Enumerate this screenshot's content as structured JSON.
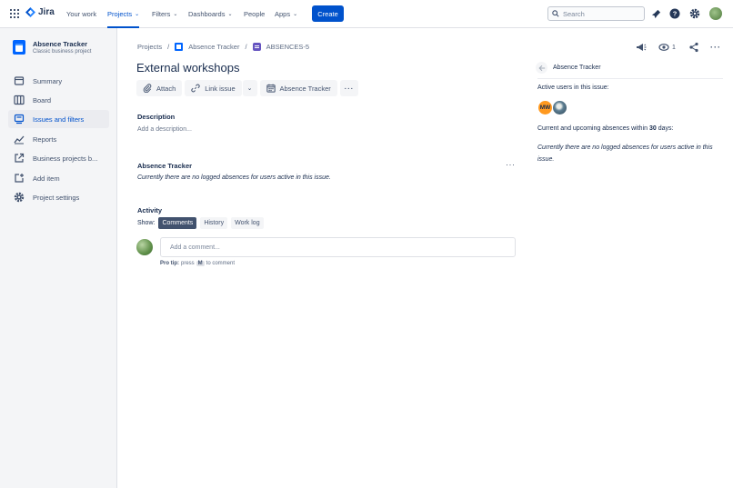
{
  "topnav": {
    "logo_text": "Jira",
    "items": [
      {
        "label": "Your work",
        "has_chevron": false,
        "active": false
      },
      {
        "label": "Projects",
        "has_chevron": true,
        "active": true
      },
      {
        "label": "Filters",
        "has_chevron": true,
        "active": false
      },
      {
        "label": "Dashboards",
        "has_chevron": true,
        "active": false
      },
      {
        "label": "People",
        "has_chevron": false,
        "active": false
      },
      {
        "label": "Apps",
        "has_chevron": true,
        "active": false
      }
    ],
    "create_label": "Create",
    "search_placeholder": "Search",
    "accent_color": "#0052cc"
  },
  "sidebar": {
    "project_name": "Absence Tracker",
    "project_type": "Classic business project",
    "items": [
      {
        "label": "Summary",
        "icon": "summary-icon",
        "active": false
      },
      {
        "label": "Board",
        "icon": "board-icon",
        "active": false
      },
      {
        "label": "Issues and filters",
        "icon": "issues-icon",
        "active": true
      },
      {
        "label": "Reports",
        "icon": "reports-icon",
        "active": false
      },
      {
        "label": "Business projects b...",
        "icon": "external-link-icon",
        "active": false
      },
      {
        "label": "Add item",
        "icon": "add-item-icon",
        "active": false
      },
      {
        "label": "Project settings",
        "icon": "gear-icon",
        "active": false
      }
    ]
  },
  "breadcrumb": {
    "projects": "Projects",
    "project": "Absence Tracker",
    "issue_key": "ABSENCES-5"
  },
  "issue": {
    "title": "External workshops",
    "watchers_count": "1"
  },
  "toolbar": {
    "attach": "Attach",
    "link_issue": "Link issue",
    "absence_tracker": "Absence Tracker"
  },
  "description": {
    "label": "Description",
    "placeholder": "Add a description..."
  },
  "absence_section": {
    "label": "Absence Tracker",
    "text": "Currently there are no logged absences for users active in this issue."
  },
  "activity": {
    "label": "Activity",
    "show_label": "Show:",
    "tabs": [
      "Comments",
      "History",
      "Work log"
    ],
    "selected_tab": "Comments",
    "comment_placeholder": "Add a comment...",
    "pro_tip_label": "Pro tip:",
    "pro_tip_press": "press",
    "pro_tip_key": "M",
    "pro_tip_suffix": "to comment"
  },
  "panel": {
    "title": "Absence Tracker",
    "active_users_label": "Active users in this issue:",
    "avatar_initials": "MW",
    "upcoming_prefix": "Current and upcoming absences within",
    "upcoming_days": "30",
    "upcoming_suffix": "days:",
    "none_text": "Currently there are no logged absences for users active in this issue."
  }
}
